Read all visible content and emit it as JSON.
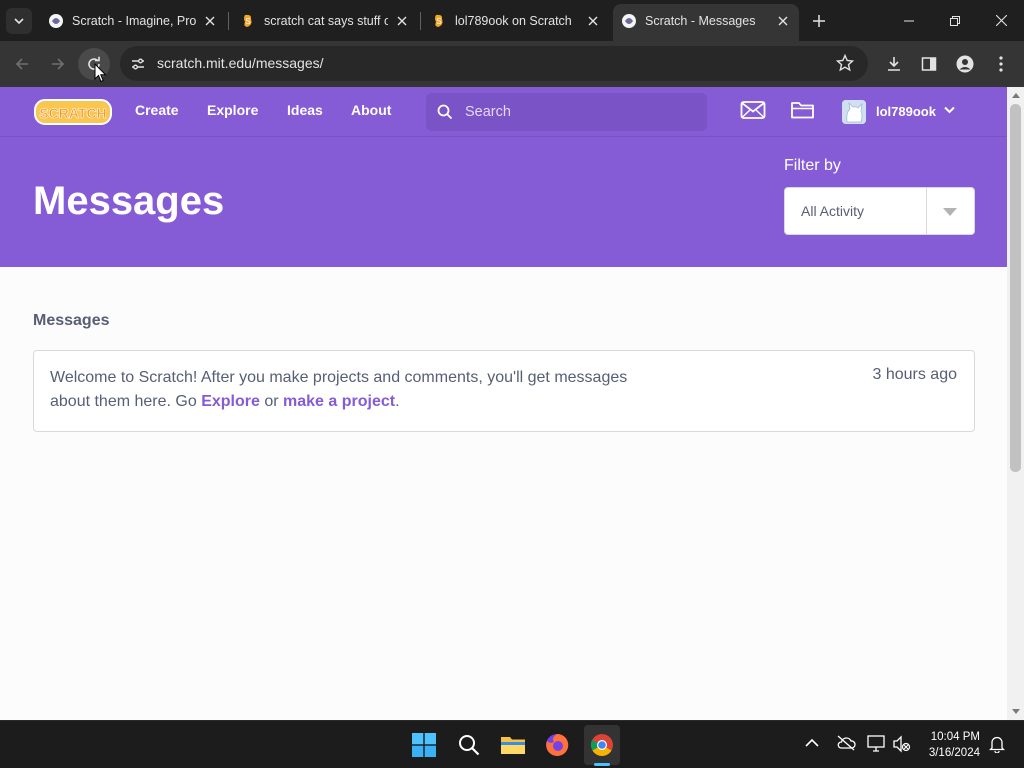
{
  "browser": {
    "tabs": [
      {
        "title": "Scratch - Imagine, Program",
        "favicon": "scratch-round-icon",
        "active": false
      },
      {
        "title": "scratch cat says stuff on",
        "favicon": "scratch-s-icon",
        "active": false
      },
      {
        "title": "lol789ook on Scratch",
        "favicon": "scratch-s-icon",
        "active": false
      },
      {
        "title": "Scratch - Messages",
        "favicon": "scratch-round-icon",
        "active": true
      }
    ],
    "url": "scratch.mit.edu/messages/"
  },
  "nav": {
    "logo_text": "SCRATCH",
    "links": [
      "Create",
      "Explore",
      "Ideas",
      "About"
    ],
    "search_placeholder": "Search",
    "username": "lol789ook"
  },
  "hero": {
    "title": "Messages",
    "filter_label": "Filter by",
    "filter_value": "All Activity"
  },
  "messages": {
    "section_title": "Messages",
    "items": [
      {
        "text_before": "Welcome to Scratch! After you make projects and comments, you'll get messages about them here. Go ",
        "link1": "Explore",
        "text_middle": " or ",
        "link2": "make a project",
        "text_after": ".",
        "time": "3 hours ago"
      }
    ]
  },
  "taskbar": {
    "time": "10:04 PM",
    "date": "3/16/2024"
  },
  "colors": {
    "scratch_purple": "#855cd6",
    "text_gray": "#575e75"
  }
}
